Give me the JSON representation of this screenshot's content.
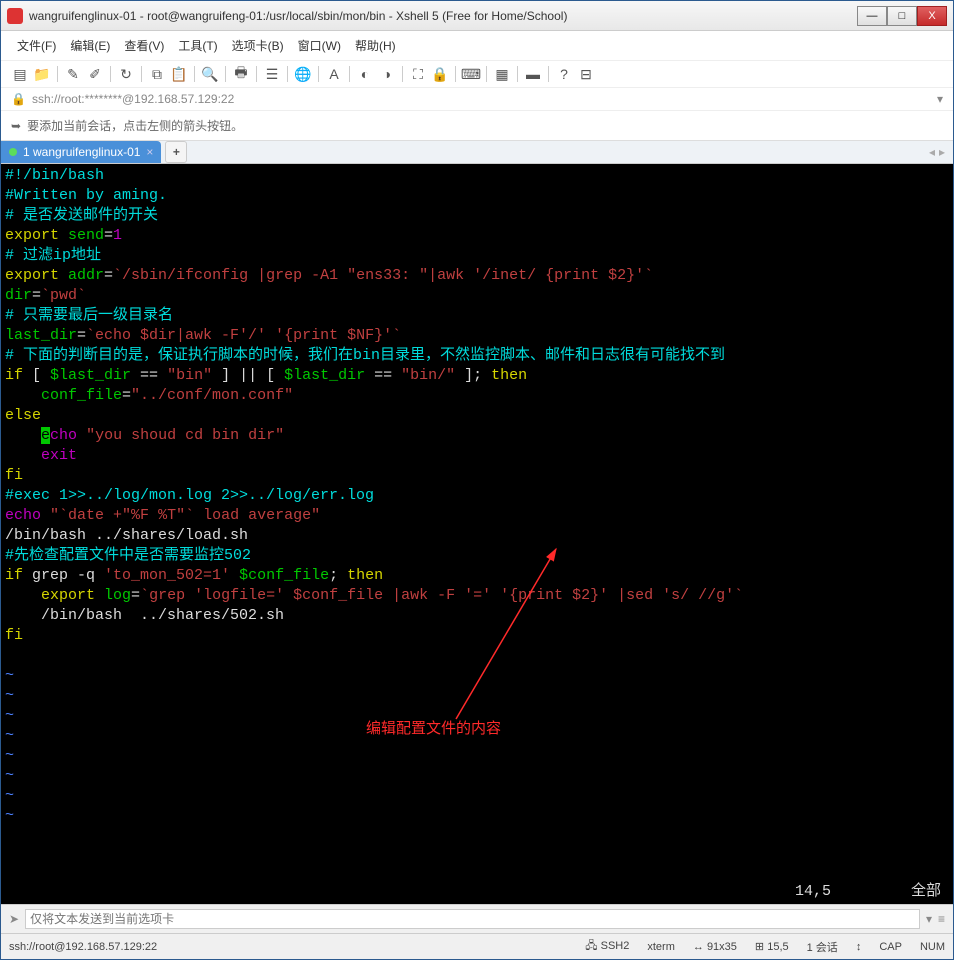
{
  "titlebar": {
    "title": "wangruifenglinux-01 - root@wangruifeng-01:/usr/local/sbin/mon/bin - Xshell 5 (Free for Home/School)"
  },
  "menubar": [
    "文件(F)",
    "编辑(E)",
    "查看(V)",
    "工具(T)",
    "选项卡(B)",
    "窗口(W)",
    "帮助(H)"
  ],
  "addrbar": {
    "text": "ssh://root:********@192.168.57.129:22"
  },
  "tipbar": {
    "text": "要添加当前会话，点击左侧的箭头按钮。"
  },
  "tab": {
    "label": "1 wangruifenglinux-01"
  },
  "terminal": {
    "lines": [
      {
        "segs": [
          {
            "t": "#!/bin/bash",
            "c": "c-cyan"
          }
        ]
      },
      {
        "segs": [
          {
            "t": "#Written by aming.",
            "c": "c-cyan"
          }
        ]
      },
      {
        "segs": [
          {
            "t": "# 是否发送邮件的开关",
            "c": "c-cyan"
          }
        ]
      },
      {
        "segs": [
          {
            "t": "export",
            "c": "c-yellow"
          },
          {
            "t": " send",
            "c": "c-green"
          },
          {
            "t": "=",
            "c": "c-white"
          },
          {
            "t": "1",
            "c": "c-purple"
          }
        ]
      },
      {
        "segs": [
          {
            "t": "# 过滤ip地址",
            "c": "c-cyan"
          }
        ]
      },
      {
        "segs": [
          {
            "t": "export",
            "c": "c-yellow"
          },
          {
            "t": " addr",
            "c": "c-green"
          },
          {
            "t": "=",
            "c": "c-white"
          },
          {
            "t": "`/sbin/ifconfig |grep -A1 \"ens33: \"|awk '/inet/ {print $2}'`",
            "c": "c-reddk"
          }
        ]
      },
      {
        "segs": [
          {
            "t": "dir",
            "c": "c-green"
          },
          {
            "t": "=",
            "c": "c-white"
          },
          {
            "t": "`pwd`",
            "c": "c-reddk"
          }
        ]
      },
      {
        "segs": [
          {
            "t": "# 只需要最后一级目录名",
            "c": "c-cyan"
          }
        ]
      },
      {
        "segs": [
          {
            "t": "last_dir",
            "c": "c-green"
          },
          {
            "t": "=",
            "c": "c-white"
          },
          {
            "t": "`echo $dir|awk -F'/' '{print $NF}'`",
            "c": "c-reddk"
          }
        ]
      },
      {
        "segs": [
          {
            "t": "# 下面的判断目的是，保证执行脚本的时候，我们在bin目录里，不然监控脚本、邮件和日志很有可能找不到",
            "c": "c-cyan"
          }
        ]
      },
      {
        "segs": [
          {
            "t": "if",
            "c": "c-yellow"
          },
          {
            "t": " [ ",
            "c": "c-white"
          },
          {
            "t": "$last_dir",
            "c": "c-green"
          },
          {
            "t": " == ",
            "c": "c-white"
          },
          {
            "t": "\"bin\"",
            "c": "c-reddk"
          },
          {
            "t": " ] || [ ",
            "c": "c-white"
          },
          {
            "t": "$last_dir",
            "c": "c-green"
          },
          {
            "t": " == ",
            "c": "c-white"
          },
          {
            "t": "\"bin/\"",
            "c": "c-reddk"
          },
          {
            "t": " ]; ",
            "c": "c-white"
          },
          {
            "t": "then",
            "c": "c-yellow"
          }
        ]
      },
      {
        "segs": [
          {
            "t": "    ",
            "c": "c-white"
          },
          {
            "t": "conf_file",
            "c": "c-green"
          },
          {
            "t": "=",
            "c": "c-white"
          },
          {
            "t": "\"../conf/mon.conf\"",
            "c": "c-reddk"
          }
        ]
      },
      {
        "segs": [
          {
            "t": "else",
            "c": "c-yellow"
          }
        ]
      },
      {
        "segs": [
          {
            "t": "    ",
            "c": "c-white"
          },
          {
            "t": "e",
            "c": "cursor-hl"
          },
          {
            "t": "cho",
            "c": "c-purple"
          },
          {
            "t": " ",
            "c": "c-white"
          },
          {
            "t": "\"you shoud cd bin dir\"",
            "c": "c-reddk"
          }
        ]
      },
      {
        "segs": [
          {
            "t": "    ",
            "c": "c-white"
          },
          {
            "t": "exit",
            "c": "c-purple"
          }
        ]
      },
      {
        "segs": [
          {
            "t": "fi",
            "c": "c-yellow"
          }
        ]
      },
      {
        "segs": [
          {
            "t": "#exec 1>>../log/mon.log 2>>../log/err.log",
            "c": "c-cyan"
          }
        ]
      },
      {
        "segs": [
          {
            "t": "echo",
            "c": "c-purple"
          },
          {
            "t": " ",
            "c": "c-white"
          },
          {
            "t": "\"",
            "c": "c-reddk"
          },
          {
            "t": "`date +\"%F %T\"`",
            "c": "c-reddk"
          },
          {
            "t": " load average\"",
            "c": "c-reddk"
          }
        ]
      },
      {
        "segs": [
          {
            "t": "/bin/bash ../shares/load.sh",
            "c": "c-white"
          }
        ]
      },
      {
        "segs": [
          {
            "t": "#先检查配置文件中是否需要监控502",
            "c": "c-cyan"
          }
        ]
      },
      {
        "segs": [
          {
            "t": "if",
            "c": "c-yellow"
          },
          {
            "t": " grep -q ",
            "c": "c-white"
          },
          {
            "t": "'to_mon_502=1'",
            "c": "c-reddk"
          },
          {
            "t": " ",
            "c": "c-white"
          },
          {
            "t": "$conf_file",
            "c": "c-green"
          },
          {
            "t": "; ",
            "c": "c-white"
          },
          {
            "t": "then",
            "c": "c-yellow"
          }
        ]
      },
      {
        "segs": [
          {
            "t": "    ",
            "c": "c-white"
          },
          {
            "t": "export",
            "c": "c-yellow"
          },
          {
            "t": " log",
            "c": "c-green"
          },
          {
            "t": "=",
            "c": "c-white"
          },
          {
            "t": "`grep 'logfile=' $conf_file |awk -F '=' '{print $2}' |sed 's/ //g'`",
            "c": "c-reddk"
          }
        ]
      },
      {
        "segs": [
          {
            "t": "    /bin/bash  ../shares/502.sh",
            "c": "c-white"
          }
        ]
      },
      {
        "segs": [
          {
            "t": "fi",
            "c": "c-yellow"
          }
        ]
      }
    ],
    "tildes": 8,
    "pos": "14,5",
    "scroll": "全部"
  },
  "annotation": {
    "text": "编辑配置文件的内容"
  },
  "inputbar": {
    "placeholder": "仅将文本发送到当前选项卡"
  },
  "statusbar": {
    "left": "ssh://root@192.168.57.129:22",
    "items": [
      "SSH2",
      "xterm",
      "91x35",
      "15,5",
      "1 会话",
      "CAP",
      "NUM"
    ]
  }
}
